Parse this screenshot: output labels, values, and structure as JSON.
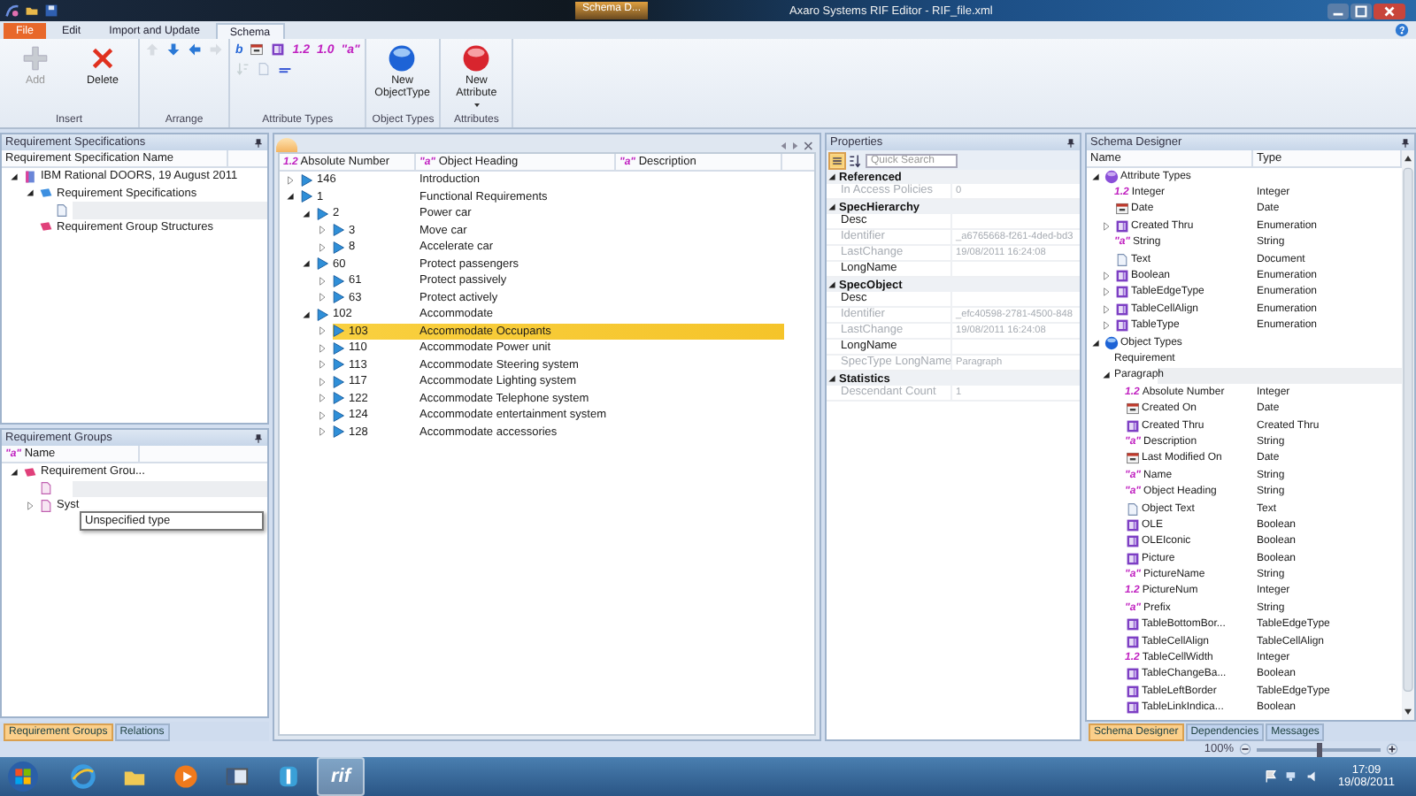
{
  "window": {
    "title": "Axaro Systems RIF Editor - RIF_file.xml",
    "context_tab": "Schema D..."
  },
  "ribbon_tabs": [
    {
      "label": "File",
      "kind": "file",
      "selected": false
    },
    {
      "label": "Edit",
      "kind": "tab",
      "selected": false
    },
    {
      "label": "Import and Update",
      "kind": "tab",
      "selected": false
    },
    {
      "label": "Schema",
      "kind": "tab",
      "selected": true
    }
  ],
  "ribbon_groups": [
    {
      "label": "Insert",
      "rows": [
        [
          {
            "kind": "add",
            "label": "Add",
            "disabled": true
          },
          {
            "kind": "delete",
            "label": "Delete",
            "disabled": false
          }
        ]
      ]
    },
    {
      "label": "Arrange",
      "rows": [
        [
          {
            "kind": "up",
            "disabled": true
          },
          {
            "kind": "down",
            "disabled": false
          },
          {
            "kind": "left",
            "disabled": false
          },
          {
            "kind": "right",
            "disabled": true
          }
        ]
      ]
    },
    {
      "label": "Attribute Types",
      "rows": [
        [
          {
            "kind": "glyph",
            "glyph": "b",
            "disabled": false
          },
          {
            "kind": "date",
            "disabled": false
          },
          {
            "kind": "enum",
            "disabled": false
          },
          {
            "kind": "glyph",
            "glyph": "1.2",
            "disabled": false
          },
          {
            "kind": "glyph",
            "glyph": "1.0",
            "disabled": false
          },
          {
            "kind": "glyph",
            "glyph": "\"a\"",
            "disabled": false
          }
        ],
        [
          {
            "kind": "sort",
            "disabled": true
          },
          {
            "kind": "page",
            "disabled": true
          },
          {
            "kind": "xml",
            "disabled": false
          }
        ]
      ]
    },
    {
      "label": "Object Types",
      "rows": [
        [
          {
            "kind": "objecttype",
            "label": "New ObjectType",
            "disabled": false
          }
        ]
      ]
    },
    {
      "label": "Attributes",
      "rows": [
        [
          {
            "kind": "attribute",
            "label": "New Attribute",
            "dropdown": true,
            "disabled": false
          }
        ]
      ]
    }
  ],
  "spec_panel": {
    "title": "Requirement Specifications",
    "column": "Requirement Specification Name",
    "tree": [
      {
        "label": "IBM Rational DOORS, 19 August 2011",
        "kind": "doors",
        "expanded": true,
        "selected": false,
        "children": [
          {
            "label": "Requirement Specifications",
            "kind": "spec",
            "expanded": true,
            "selected": false,
            "children": [
              {
                "kind": "doc",
                "selected": true
              }
            ]
          },
          {
            "label": "Requirement Group Structures",
            "kind": "group",
            "selected": false
          }
        ]
      }
    ]
  },
  "groups_panel": {
    "title": "Requirement Groups",
    "column": {
      "glyph": "\"a\"",
      "label": "Name"
    },
    "tree": [
      {
        "label": "Requirement Grou...",
        "kind": "group",
        "expanded": true,
        "selected": false,
        "children": [
          {
            "kind": "docpink",
            "selected": true
          },
          {
            "label": "Syst",
            "kind": "docpink",
            "expanded": false,
            "selected": false
          }
        ]
      }
    ],
    "tooltip": "Unspecified type"
  },
  "left_tabs": [
    {
      "label": "Requirement Groups",
      "selected": true
    },
    {
      "label": "Relations",
      "selected": false
    }
  ],
  "document": {
    "columns": [
      {
        "glyph": "1.2",
        "label": "Absolute Number"
      },
      {
        "glyph": "\"a\"",
        "label": "Object Heading"
      },
      {
        "glyph": "\"a\"",
        "label": "Description"
      }
    ],
    "rows": [
      {
        "number": "146",
        "heading": "Introduction",
        "expanded": false,
        "selected": false
      },
      {
        "number": "1",
        "heading": "Functional Requirements",
        "expanded": true,
        "selected": false,
        "children": [
          {
            "number": "2",
            "heading": "Power car",
            "expanded": true,
            "selected": false,
            "children": [
              {
                "number": "3",
                "heading": "Move car",
                "expanded": false,
                "selected": false
              },
              {
                "number": "8",
                "heading": "Accelerate car",
                "expanded": false,
                "selected": false
              }
            ]
          },
          {
            "number": "60",
            "heading": "Protect passengers",
            "expanded": true,
            "selected": false,
            "children": [
              {
                "number": "61",
                "heading": "Protect passively",
                "expanded": false,
                "selected": false
              },
              {
                "number": "63",
                "heading": "Protect actively",
                "expanded": false,
                "selected": false
              }
            ]
          },
          {
            "number": "102",
            "heading": "Accommodate",
            "expanded": true,
            "selected": false,
            "children": [
              {
                "number": "103",
                "heading": "Accommodate Occupants",
                "expanded": false,
                "selected": true
              },
              {
                "number": "110",
                "heading": "Accommodate Power unit",
                "expanded": false,
                "selected": false
              },
              {
                "number": "113",
                "heading": "Accommodate Steering system",
                "expanded": false,
                "selected": false
              },
              {
                "number": "117",
                "heading": "Accommodate Lighting system",
                "expanded": false,
                "selected": false
              },
              {
                "number": "122",
                "heading": "Accommodate Telephone system",
                "expanded": false,
                "selected": false
              },
              {
                "number": "124",
                "heading": "Accommodate entertainment system",
                "expanded": false,
                "selected": false
              },
              {
                "number": "128",
                "heading": "Accommodate accessories",
                "expanded": false,
                "selected": false
              }
            ]
          }
        ]
      }
    ]
  },
  "properties": {
    "title": "Properties",
    "search": {
      "placeholder": "Quick Search"
    },
    "view_buttons": [
      {
        "kind": "categorized",
        "selected": true
      },
      {
        "kind": "alphabetical",
        "selected": false
      }
    ],
    "sections": [
      {
        "title": "Referenced",
        "rows": [
          {
            "name": "In Access Policies",
            "value": "0",
            "disabled": true
          }
        ]
      },
      {
        "title": "SpecHierarchy",
        "rows": [
          {
            "name": "Desc",
            "disabled": false
          },
          {
            "name": "Identifier",
            "value": "_a6765668-f261-4ded-bd3",
            "disabled": true
          },
          {
            "name": "LastChange",
            "value": "19/08/2011 16:24:08",
            "disabled": true
          },
          {
            "name": "LongName",
            "disabled": false
          }
        ]
      },
      {
        "title": "SpecObject",
        "rows": [
          {
            "name": "Desc",
            "disabled": false
          },
          {
            "name": "Identifier",
            "value": "_efc40598-2781-4500-848",
            "disabled": true
          },
          {
            "name": "LastChange",
            "value": "19/08/2011 16:24:08",
            "disabled": true
          },
          {
            "name": "LongName",
            "disabled": false
          },
          {
            "name": "SpecType LongName",
            "value": "Paragraph",
            "disabled": true
          }
        ]
      },
      {
        "title": "Statistics",
        "rows": [
          {
            "name": "Descendant Count",
            "value": "1",
            "disabled": true
          }
        ]
      }
    ]
  },
  "schema": {
    "title": "Schema Designer",
    "columns": [
      "Name",
      "Type"
    ],
    "tree": [
      {
        "label": "Attribute Types",
        "kind": "purple",
        "expanded": true,
        "selected": false,
        "children": [
          {
            "glyph": "1.2",
            "label": "Integer",
            "type": "Integer",
            "selected": false
          },
          {
            "kind": "date",
            "label": "Date",
            "type": "Date",
            "selected": false
          },
          {
            "kind": "enum",
            "label": "Created Thru",
            "type": "Enumeration",
            "expanded": false,
            "selected": false
          },
          {
            "glyph": "\"a\"",
            "label": "String",
            "type": "String",
            "selected": false
          },
          {
            "kind": "doc",
            "label": "Text",
            "type": "Document",
            "selected": false
          },
          {
            "kind": "enum",
            "label": "Boolean",
            "type": "Enumeration",
            "expanded": false,
            "selected": false
          },
          {
            "kind": "enum",
            "label": "TableEdgeType",
            "type": "Enumeration",
            "expanded": false,
            "selected": false
          },
          {
            "kind": "enum",
            "label": "TableCellAlign",
            "type": "Enumeration",
            "expanded": false,
            "selected": false
          },
          {
            "kind": "enum",
            "label": "TableType",
            "type": "Enumeration",
            "expanded": false,
            "selected": false
          }
        ]
      },
      {
        "label": "Object Types",
        "kind": "blue",
        "expanded": true,
        "selected": false,
        "children": [
          {
            "label": "Requirement",
            "selected": false
          },
          {
            "label": "Paragraph",
            "expanded": true,
            "selected": true,
            "children": [
              {
                "glyph": "1.2",
                "label": "Absolute Number",
                "type": "Integer",
                "selected": false
              },
              {
                "kind": "date",
                "label": "Created On",
                "type": "Date",
                "selected": false
              },
              {
                "kind": "enum",
                "label": "Created Thru",
                "type": "Created Thru",
                "selected": false
              },
              {
                "glyph": "\"a\"",
                "label": "Description",
                "type": "String",
                "selected": false
              },
              {
                "kind": "date",
                "label": "Last Modified On",
                "type": "Date",
                "selected": false
              },
              {
                "glyph": "\"a\"",
                "label": "Name",
                "type": "String",
                "selected": false
              },
              {
                "glyph": "\"a\"",
                "label": "Object Heading",
                "type": "String",
                "selected": false
              },
              {
                "kind": "doc",
                "label": "Object Text",
                "type": "Text",
                "selected": false
              },
              {
                "kind": "enum",
                "label": "OLE",
                "type": "Boolean",
                "selected": false
              },
              {
                "kind": "enum",
                "label": "OLEIconic",
                "type": "Boolean",
                "selected": false
              },
              {
                "kind": "enum",
                "label": "Picture",
                "type": "Boolean",
                "selected": false
              },
              {
                "glyph": "\"a\"",
                "label": "PictureName",
                "type": "String",
                "selected": false
              },
              {
                "glyph": "1.2",
                "label": "PictureNum",
                "type": "Integer",
                "selected": false
              },
              {
                "glyph": "\"a\"",
                "label": "Prefix",
                "type": "String",
                "selected": false
              },
              {
                "kind": "enum",
                "label": "TableBottomBor...",
                "type": "TableEdgeType",
                "selected": false
              },
              {
                "kind": "enum",
                "label": "TableCellAlign",
                "type": "TableCellAlign",
                "selected": false
              },
              {
                "glyph": "1.2",
                "label": "TableCellWidth",
                "type": "Integer",
                "selected": false
              },
              {
                "kind": "enum",
                "label": "TableChangeBa...",
                "type": "Boolean",
                "selected": false
              },
              {
                "kind": "enum",
                "label": "TableLeftBorder",
                "type": "TableEdgeType",
                "selected": false
              },
              {
                "kind": "enum",
                "label": "TableLinkIndica...",
                "type": "Boolean",
                "selected": false
              }
            ]
          }
        ]
      }
    ]
  },
  "right_tabs": [
    {
      "label": "Schema Designer",
      "selected": true
    },
    {
      "label": "Dependencies",
      "selected": false
    },
    {
      "label": "Messages",
      "selected": false
    }
  ],
  "status_bar": {
    "zoom": "100%",
    "level": 0.5
  },
  "taskbar": {
    "apps": [
      {
        "kind": "browser",
        "selected": false
      },
      {
        "kind": "folder",
        "selected": false
      },
      {
        "kind": "media",
        "selected": false
      },
      {
        "kind": "window",
        "selected": false
      },
      {
        "kind": "shield",
        "selected": false
      },
      {
        "kind": "app",
        "label": "rif",
        "selected": true
      }
    ],
    "time": "17:09",
    "date": "19/08/2011"
  }
}
